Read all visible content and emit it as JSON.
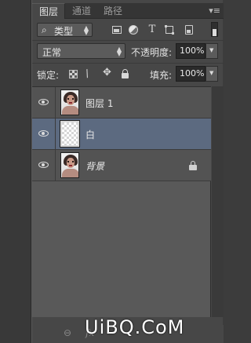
{
  "panel": {
    "tabs": [
      {
        "label": "图层",
        "close": "×"
      },
      {
        "label": "通道"
      },
      {
        "label": "路径"
      }
    ],
    "menu_icon": "▾≡"
  },
  "filter": {
    "search_icon": "⌕",
    "kind_label": "类型",
    "icons": [
      "image-filter-icon",
      "adjustment-filter-icon",
      "type-filter-icon",
      "shape-filter-icon",
      "smart-object-filter-icon"
    ],
    "type_icon_glyph": "T"
  },
  "blend": {
    "mode": "正常",
    "opacity_label": "不透明度:",
    "opacity_value": "100%"
  },
  "lock": {
    "label": "锁定:",
    "move_glyph": "✥",
    "brush_glyph": "🖌",
    "fill_label": "填充:",
    "fill_value": "100%"
  },
  "layers": [
    {
      "name": "图层 1",
      "thumbnail": "portrait",
      "selected": false,
      "locked": false
    },
    {
      "name": "白",
      "thumbnail": "transparent",
      "selected": true,
      "locked": false
    },
    {
      "name": "背景",
      "thumbnail": "portrait",
      "selected": false,
      "locked": true
    }
  ],
  "footer": {
    "link_glyph": "⊖",
    "fx_label": "fx"
  },
  "watermark": "UiBQ.CoM",
  "colors": {
    "panel_bg": "#474747",
    "list_bg": "#595959",
    "selected_row": "#5c6a80"
  }
}
